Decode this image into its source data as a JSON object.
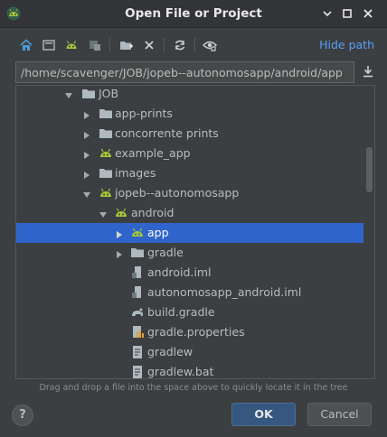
{
  "window": {
    "title": "Open File or Project",
    "minimize_glyph": "▾",
    "maximize_glyph": "▫",
    "close_glyph": "✕"
  },
  "toolbar": {
    "buttons": [
      "home-icon",
      "desktop-icon",
      "project-icon",
      "module-icon",
      "new-folder-icon",
      "delete-icon",
      "refresh-icon",
      "show-hidden-icon"
    ],
    "hide_path_label": "Hide path"
  },
  "path": {
    "value": "/home/scavenger/JOB/jopeb--autonomosapp/android/app"
  },
  "tree": {
    "items": [
      {
        "label": "JOB",
        "icon": "folder-icon",
        "expanded": true,
        "has_arrow": true
      },
      {
        "label": "app-prints",
        "icon": "folder-icon",
        "expanded": false,
        "has_arrow": true
      },
      {
        "label": "concorrente prints",
        "icon": "folder-icon",
        "expanded": false,
        "has_arrow": true
      },
      {
        "label": "example_app",
        "icon": "android-project-icon",
        "expanded": false,
        "has_arrow": true
      },
      {
        "label": "images",
        "icon": "folder-icon",
        "expanded": false,
        "has_arrow": true
      },
      {
        "label": "jopeb--autonomosapp",
        "icon": "android-project-icon",
        "expanded": true,
        "has_arrow": true
      },
      {
        "label": "android",
        "icon": "android-project-icon",
        "expanded": true,
        "has_arrow": true
      },
      {
        "label": "app",
        "icon": "android-project-icon",
        "expanded": false,
        "has_arrow": true,
        "selected": true
      },
      {
        "label": "gradle",
        "icon": "folder-icon",
        "expanded": false,
        "has_arrow": true
      },
      {
        "label": "android.iml",
        "icon": "iml-file-icon",
        "has_arrow": false
      },
      {
        "label": "autonomosapp_android.iml",
        "icon": "iml-file-icon",
        "has_arrow": false
      },
      {
        "label": "build.gradle",
        "icon": "gradle-file-icon",
        "has_arrow": false
      },
      {
        "label": "gradle.properties",
        "icon": "properties-file-icon",
        "has_arrow": false
      },
      {
        "label": "gradlew",
        "icon": "text-file-icon",
        "has_arrow": false
      },
      {
        "label": "gradlew.bat",
        "icon": "text-file-icon",
        "has_arrow": false
      }
    ]
  },
  "hint": "Drag and drop a file into the space above to quickly locate it in the tree",
  "buttons": {
    "help": "?",
    "ok": "OK",
    "cancel": "Cancel"
  },
  "colors": {
    "background": "#3c3f41",
    "selection": "#2f65ca",
    "link": "#589df6",
    "android_green": "#a4c639",
    "folder": "#aeb9c0"
  }
}
